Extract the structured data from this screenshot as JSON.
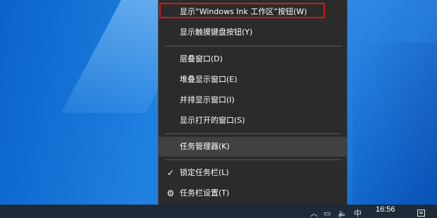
{
  "context_menu": {
    "items": [
      {
        "label": "显示“Windows Ink 工作区”按钮(W)"
      },
      {
        "label": "显示触摸键盘按钮(Y)"
      },
      {
        "label": "层叠窗口(D)"
      },
      {
        "label": "堆叠显示窗口(E)"
      },
      {
        "label": "并排显示窗口(I)"
      },
      {
        "label": "显示打开的窗口(S)"
      },
      {
        "label": "任务管理器(K)"
      },
      {
        "label": "锁定任务栏(L)",
        "checked": true
      },
      {
        "label": "任务栏设置(T)",
        "icon": "gear-icon"
      }
    ],
    "highlight_color": "#d4181f"
  },
  "taskbar": {
    "clock_time": "16:56",
    "ime_indicator": "中",
    "tray_icons": [
      "chevron-up-icon",
      "network-icon",
      "volume-icon",
      "ime-indicator",
      "notification-icon"
    ]
  }
}
